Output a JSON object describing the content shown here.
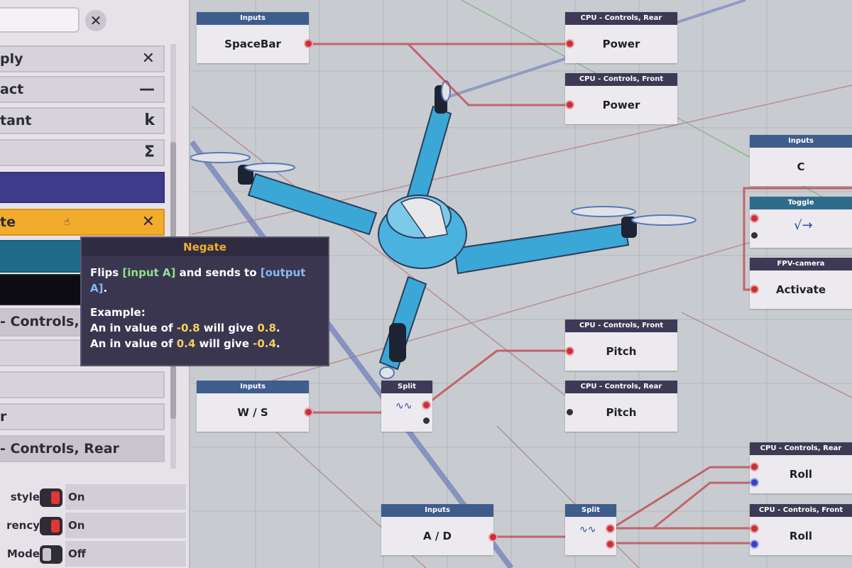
{
  "panel": {
    "items": [
      {
        "label": "ply",
        "symbol": "✕"
      },
      {
        "label": "act",
        "symbol": "—"
      },
      {
        "label": "tant",
        "symbol": "k"
      },
      {
        "label": "",
        "symbol": "Σ"
      },
      {
        "label": "",
        "symbol": ""
      },
      {
        "label": "te",
        "symbol": "✕"
      },
      {
        "label": "",
        "symbol": ""
      },
      {
        "label": "",
        "symbol": ""
      },
      {
        "label": "- Controls,",
        "symbol": ""
      },
      {
        "label": "",
        "symbol": ""
      },
      {
        "label": "",
        "symbol": ""
      },
      {
        "label": "r",
        "symbol": ""
      },
      {
        "label": "- Controls, Rear",
        "symbol": ""
      }
    ],
    "settings": [
      {
        "label": "style",
        "value": "On",
        "state": "on"
      },
      {
        "label": "rency",
        "value": "On",
        "state": "on"
      },
      {
        "label": "Mode",
        "value": "Off",
        "state": "off"
      }
    ]
  },
  "tooltip": {
    "title": "Negate",
    "line1a": "Flips ",
    "line1b": "[input A]",
    "line1c": " and sends to ",
    "line1d": "[output A]",
    "line1e": ".",
    "example": "Example:",
    "ex1a": "An in value of ",
    "ex1b": "-0.8",
    "ex1c": " will give ",
    "ex1d": "0.8",
    "ex1e": ".",
    "ex2a": "An in value of ",
    "ex2b": "0.4",
    "ex2c": " will give ",
    "ex2d": "-0.4",
    "ex2e": "."
  },
  "nodes": {
    "spacebar": {
      "header": "Inputs",
      "label": "SpaceBar"
    },
    "power_rear": {
      "header": "CPU - Controls, Rear",
      "label": "Power"
    },
    "power_front": {
      "header": "CPU - Controls, Front",
      "label": "Power"
    },
    "c_input": {
      "header": "Inputs",
      "label": "C"
    },
    "toggle": {
      "header": "Toggle",
      "label": ""
    },
    "fpv": {
      "header": "FPV-camera",
      "label": "Activate"
    },
    "pitch_front": {
      "header": "CPU - Controls, Front",
      "label": "Pitch"
    },
    "ws": {
      "header": "Inputs",
      "label": "W / S"
    },
    "split1": {
      "header": "Split",
      "label": ""
    },
    "pitch_rear": {
      "header": "CPU - Controls, Rear",
      "label": "Pitch"
    },
    "roll_rear": {
      "header": "CPU - Controls, Rear",
      "label": "Roll"
    },
    "ad": {
      "header": "Inputs",
      "label": "A / D"
    },
    "split2": {
      "header": "Split",
      "label": ""
    },
    "roll_front": {
      "header": "CPU - Controls, Front",
      "label": "Roll"
    }
  }
}
